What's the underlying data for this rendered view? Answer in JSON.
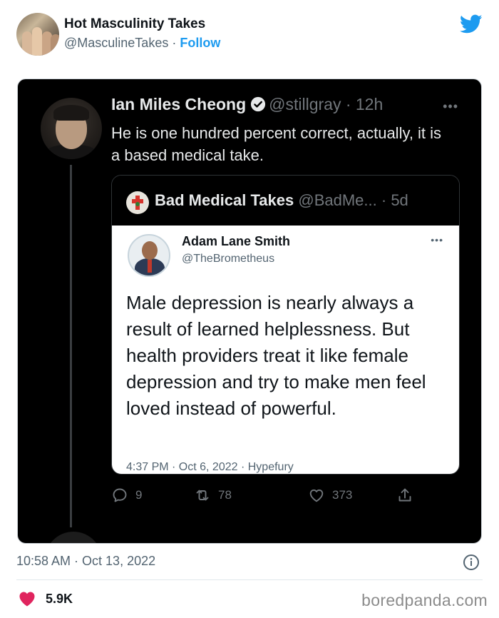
{
  "embed": {
    "author_name": "Hot Masculinity Takes",
    "author_handle": "@MasculineTakes",
    "separator": "·",
    "follow_label": "Follow",
    "timestamp": "10:58 AM · Oct 13, 2022",
    "likes_count": "5.9K",
    "watermark": "boredpanda.com"
  },
  "inner_tweet": {
    "name": "Ian Miles Cheong",
    "handle": "@stillgray",
    "time": "· 12h",
    "more": "•••",
    "text": "He is one hundred percent correct, actually, it is a based medical take.",
    "replies": "9",
    "retweets": "78",
    "likes": "373"
  },
  "quote": {
    "name": "Bad Medical Takes",
    "handle": "@BadMe...",
    "time": "· 5d"
  },
  "screenshot_tweet": {
    "name": "Adam Lane Smith",
    "handle": "@TheBrometheus",
    "more": "•••",
    "text": "Male depression is nearly always a result of learned helplessness. But health providers treat it like female depression and try to make men feel loved instead of powerful.",
    "meta": "4:37 PM · Oct 6, 2022 · Hypefury"
  },
  "colors": {
    "twitter_blue": "#1d9bf0",
    "heart_pink": "#e0245e",
    "dark_bg": "#000000"
  },
  "icons": [
    "twitter-bird-icon",
    "verified-icon",
    "reply-icon",
    "retweet-icon",
    "like-icon",
    "share-icon",
    "info-icon",
    "heart-icon"
  ]
}
